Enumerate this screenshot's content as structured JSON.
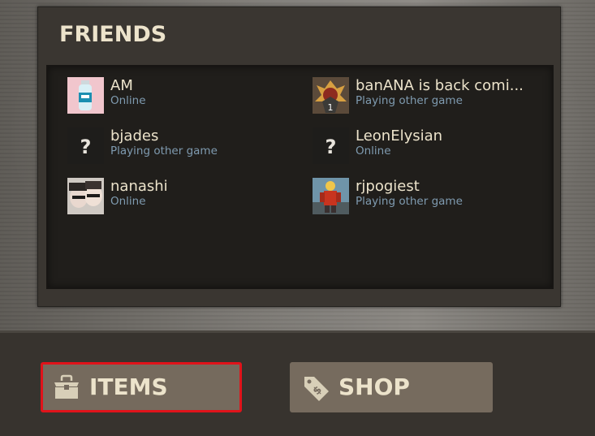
{
  "panel": {
    "title": "FRIENDS"
  },
  "friends": [
    {
      "name": "AM",
      "status": "Online",
      "status_type": "online",
      "avatar": "water-bottle-avatar"
    },
    {
      "name": "banANA is back comi...",
      "status": "Playing other game",
      "status_type": "playing",
      "avatar": "medal-avatar"
    },
    {
      "name": "bjades",
      "status": "Playing other game",
      "status_type": "playing",
      "avatar": "question-mark-avatar"
    },
    {
      "name": "LeonElysian",
      "status": "Online",
      "status_type": "online",
      "avatar": "question-mark-avatar"
    },
    {
      "name": "nanashi",
      "status": "Online",
      "status_type": "online",
      "avatar": "photo-avatar"
    },
    {
      "name": "rjpogiest",
      "status": "Playing other game",
      "status_type": "playing",
      "avatar": "soldier-avatar"
    }
  ],
  "buttons": {
    "items_label": "ITEMS",
    "shop_label": "SHOP",
    "items_icon": "toolbox-icon",
    "shop_icon": "price-tag-icon"
  },
  "colors": {
    "title_text": "#ece3cb",
    "status_text": "#7f9bb0",
    "button_bg": "#766b5e",
    "highlight_border": "#e0131a"
  }
}
